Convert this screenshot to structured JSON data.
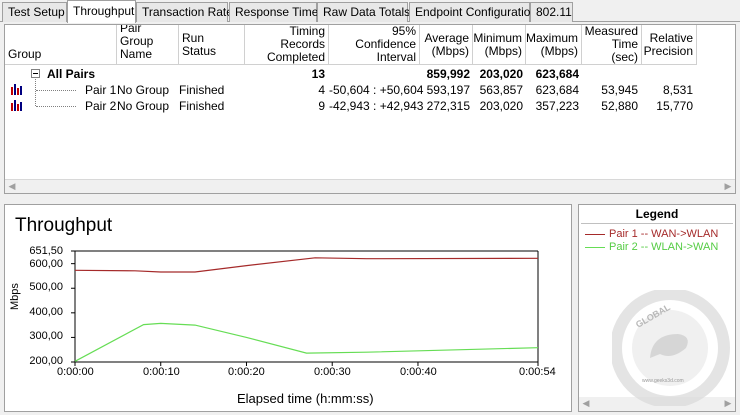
{
  "tabs": [
    {
      "label": "Test Setup",
      "active": false
    },
    {
      "label": "Throughput",
      "active": true
    },
    {
      "label": "Transaction Rate",
      "active": false
    },
    {
      "label": "Response Time",
      "active": false
    },
    {
      "label": "Raw Data Totals",
      "active": false
    },
    {
      "label": "Endpoint Configuration",
      "active": false
    },
    {
      "label": "802.11",
      "active": false
    }
  ],
  "grid": {
    "headers": {
      "group": "Group",
      "pair_group_name": "Pair Group Name",
      "run_status": "Run Status",
      "timing_records": "Timing Records Completed",
      "confidence": "95% Confidence Interval",
      "average": "Average (Mbps)",
      "minimum": "Minimum (Mbps)",
      "maximum": "Maximum (Mbps)",
      "measured_time": "Measured Time (sec)",
      "relative_precision": "Relative Precision"
    },
    "all_pairs": {
      "label": "All Pairs",
      "timing_records": "13",
      "average": "859,992",
      "minimum": "203,020",
      "maximum": "623,684"
    },
    "rows": [
      {
        "group": "Pair 1",
        "pair_group_name": "No Group",
        "run_status": "Finished",
        "timing_records": "4",
        "confidence": "-50,604 : +50,604",
        "average": "593,197",
        "minimum": "563,857",
        "maximum": "623,684",
        "measured_time": "53,945",
        "relative_precision": "8,531"
      },
      {
        "group": "Pair 2",
        "pair_group_name": "No Group",
        "run_status": "Finished",
        "timing_records": "9",
        "confidence": "-42,943 : +42,943",
        "average": "272,315",
        "minimum": "203,020",
        "maximum": "357,223",
        "measured_time": "52,880",
        "relative_precision": "15,770"
      }
    ]
  },
  "chart_data": {
    "type": "line",
    "title": "Throughput",
    "xlabel": "Elapsed time (h:mm:ss)",
    "ylabel": "Mbps",
    "ylim": [
      200,
      651.5
    ],
    "xlim": [
      "0:00:00",
      "0:00:54"
    ],
    "y_ticks": [
      "651,50",
      "600,00",
      "500,00",
      "400,00",
      "300,00",
      "200,00"
    ],
    "x_ticks": [
      "0:00:00",
      "0:00:10",
      "0:00:20",
      "0:00:30",
      "0:00:40",
      "0:00:54"
    ],
    "series": [
      {
        "name": "Pair 1 -- WAN->WLAN",
        "color": "#a52a2a",
        "x": [
          "0:00:00",
          "0:00:07",
          "0:00:10",
          "0:00:14",
          "0:00:20",
          "0:00:28",
          "0:00:34",
          "0:00:54"
        ],
        "y": [
          573,
          571,
          566,
          566,
          592,
          624,
          620,
          622
        ]
      },
      {
        "name": "Pair 2 -- WLAN->WAN",
        "color": "#66dd55",
        "x": [
          "0:00:00",
          "0:00:08",
          "0:00:10",
          "0:00:14",
          "0:00:20",
          "0:00:27",
          "0:00:34",
          "0:00:54"
        ],
        "y": [
          203,
          352,
          357,
          350,
          300,
          236,
          240,
          258
        ]
      }
    ]
  },
  "legend": {
    "title": "Legend",
    "items": [
      "Pair 1 -- WAN->WLAN",
      "Pair 2 -- WLAN->WAN"
    ],
    "colors": [
      "#a52a2a",
      "#66dd55"
    ]
  },
  "watermark": {
    "top_text": "GLOBAL",
    "small_text": "www.geeks3d.com"
  }
}
